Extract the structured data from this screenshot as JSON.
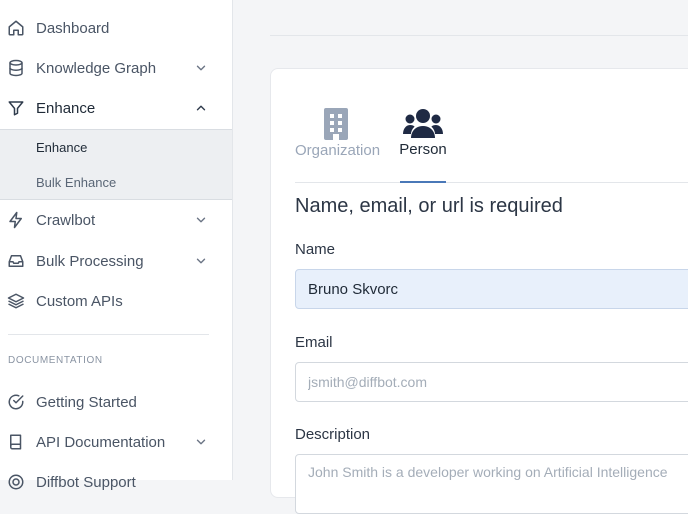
{
  "sidebar": {
    "items": [
      {
        "label": "Dashboard",
        "icon": "home-icon"
      },
      {
        "label": "Knowledge Graph",
        "icon": "database-icon"
      },
      {
        "label": "Enhance",
        "icon": "filter-icon"
      },
      {
        "label": "Crawlbot",
        "icon": "lightning-icon"
      },
      {
        "label": "Bulk Processing",
        "icon": "inbox-icon"
      },
      {
        "label": "Custom APIs",
        "icon": "layers-icon"
      }
    ],
    "enhance_sub": [
      "Enhance",
      "Bulk Enhance"
    ],
    "doc_section": "DOCUMENTATION",
    "doc_items": [
      {
        "label": "Getting Started",
        "icon": "check-circle-icon"
      },
      {
        "label": "API Documentation",
        "icon": "book-icon"
      },
      {
        "label": "Diffbot Support",
        "icon": "support-icon"
      }
    ]
  },
  "tabs": [
    {
      "label": "Organization",
      "icon": "building-icon"
    },
    {
      "label": "Person",
      "icon": "users-icon"
    }
  ],
  "form": {
    "heading": "Name, email, or url is required",
    "name_label": "Name",
    "name_value": "Bruno Skvorc",
    "email_label": "Email",
    "email_placeholder": "jsmith@diffbot.com",
    "description_label": "Description",
    "description_placeholder": "John Smith is a developer working on Artificial Intelligence"
  },
  "colors": {
    "accent": "#4a78b8",
    "active_icon": "#1f2a44",
    "inactive_icon": "#9aa6b8",
    "filled_input": "#e8f0fb"
  }
}
